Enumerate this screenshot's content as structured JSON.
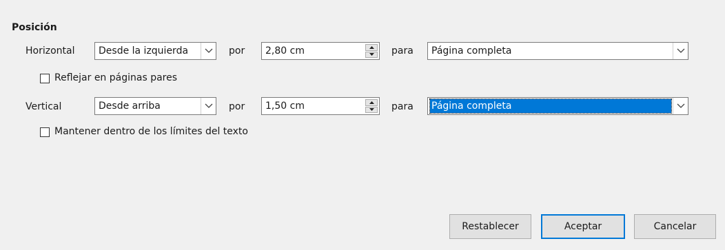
{
  "section": {
    "title": "Posición"
  },
  "horizontal": {
    "label": "Horizontal",
    "position": "Desde la izquierda",
    "by_label": "por",
    "by_value": "2,80 cm",
    "to_label": "para",
    "to_value": "Página completa"
  },
  "mirror": {
    "label": "Reflejar en páginas pares",
    "checked": false
  },
  "vertical": {
    "label": "Vertical",
    "position": "Desde arriba",
    "by_label": "por",
    "by_value": "1,50 cm",
    "to_label": "para",
    "to_value": "Página completa"
  },
  "keep_inside": {
    "label": "Mantener dentro de los límites del texto",
    "checked": false
  },
  "buttons": {
    "reset": "Restablecer",
    "ok": "Aceptar",
    "cancel": "Cancelar"
  },
  "icons": {
    "dropdown": "chevron-down-icon",
    "spin_up": "triangle-up-icon",
    "spin_down": "triangle-down-icon"
  },
  "colors": {
    "selection": "#0078d7",
    "default_button_border": "#0078d7"
  }
}
